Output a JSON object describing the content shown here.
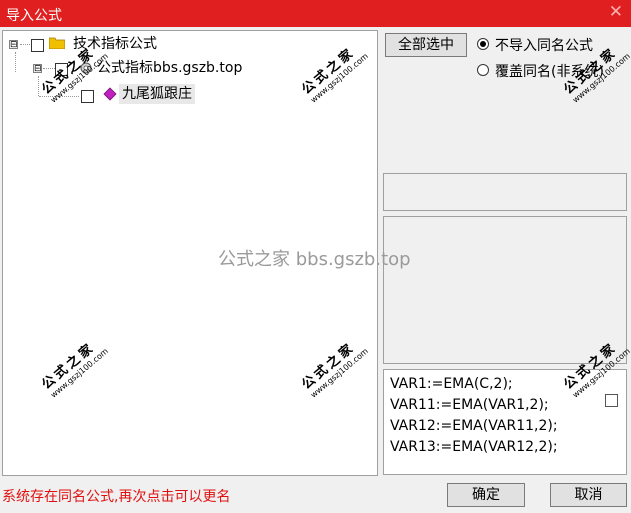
{
  "window": {
    "title": "导入公式",
    "close_glyph": "✕"
  },
  "tree": {
    "root": {
      "label": "技术指标公式",
      "expander": "⊟",
      "icon": "folder-icon"
    },
    "child": {
      "label": "公式指标bbs.gszb.top",
      "expander": "⊟",
      "icon": "gear-icon"
    },
    "leaf": {
      "label": "九尾狐跟庄",
      "icon": "diamond-icon"
    }
  },
  "options": {
    "select_all_label": "全部选中",
    "radio_skip_label": "不导入同名公式",
    "radio_overwrite_label": "覆盖同名(非系统)",
    "selected_option": "skip"
  },
  "formula_lines": [
    "VAR1:=EMA(C,2);",
    "VAR11:=EMA(VAR1,2);",
    "VAR12:=EMA(VAR11,2);",
    "VAR13:=EMA(VAR12,2);"
  ],
  "status_message": "系统存在同名公式,再次点击可以更名",
  "buttons": {
    "ok_label": "确定",
    "cancel_label": "取消"
  },
  "watermark": {
    "center_text": "公式之家 bbs.gszb.top",
    "stamp_cn": "公式之家",
    "stamp_url": "www.gszj100.com"
  },
  "colors": {
    "titlebar": "#e02020",
    "status_text": "#e01010",
    "diamond_icon": "#c020c0",
    "folder_icon": "#f0c000"
  }
}
